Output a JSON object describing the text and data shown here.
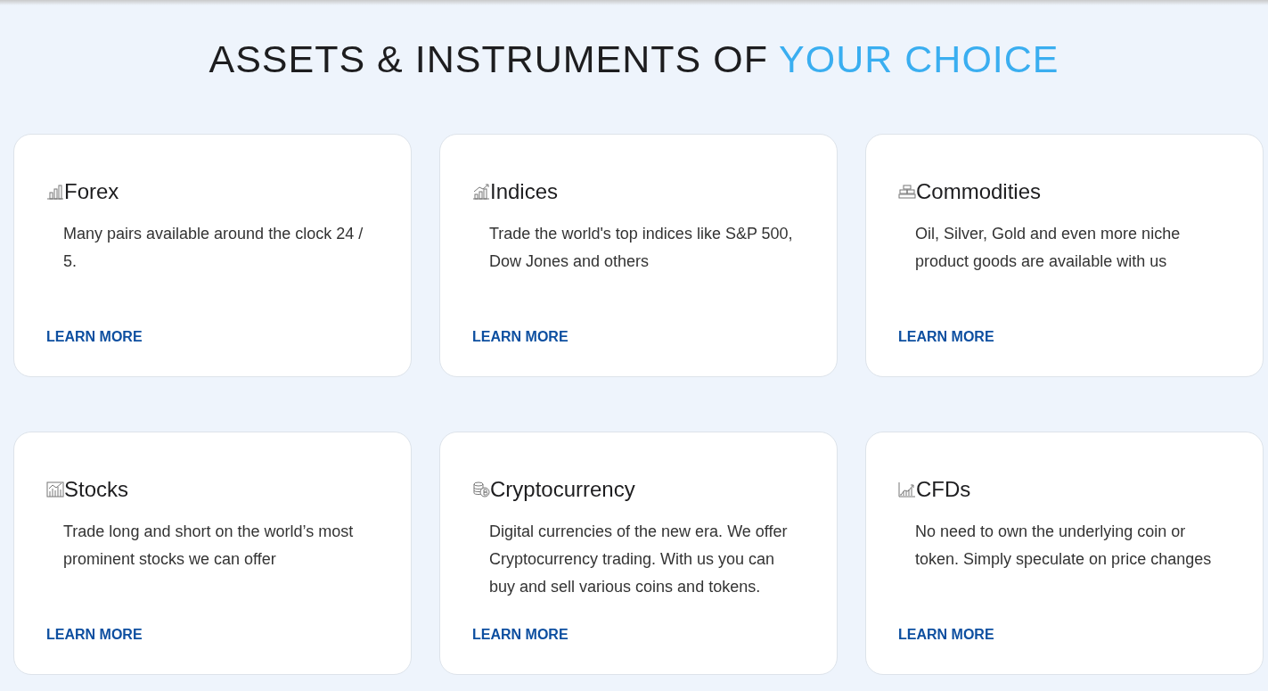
{
  "heading": {
    "text": "ASSETS & INSTRUMENTS OF ",
    "highlight": "YOUR CHOICE"
  },
  "cards": [
    {
      "title": "Forex",
      "description": "Many pairs available around the clock 24 / 5.",
      "link": "LEARN MORE"
    },
    {
      "title": "Indices",
      "description": "Trade the world's top indices like S&P 500, Dow Jones and others",
      "link": "LEARN MORE"
    },
    {
      "title": "Commodities",
      "description": "Oil, Silver, Gold and even more niche product goods are available with us",
      "link": "LEARN MORE"
    },
    {
      "title": "Stocks",
      "description": "Trade long and short on the world’s most prominent stocks we can offer",
      "link": "LEARN MORE"
    },
    {
      "title": "Cryptocurrency",
      "description": "Digital currencies of the new era. We offer Cryptocurrency trading. With us you can buy and sell various coins and tokens.",
      "link": "LEARN MORE"
    },
    {
      "title": "CFDs",
      "description": "No need to own the underlying coin or token. Simply speculate on price changes",
      "link": "LEARN MORE"
    }
  ]
}
